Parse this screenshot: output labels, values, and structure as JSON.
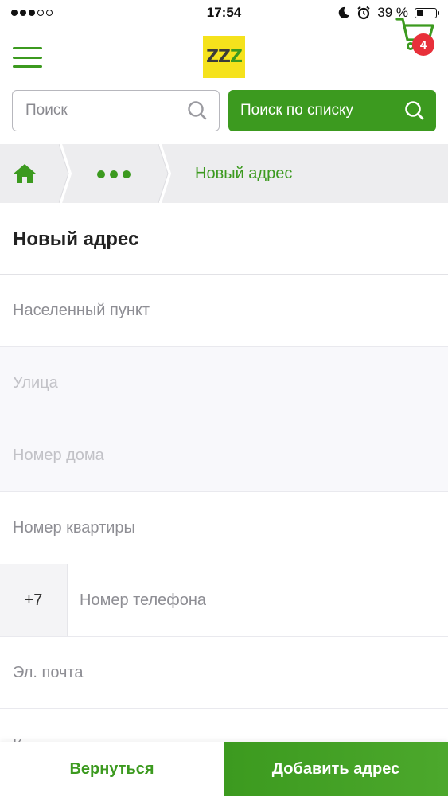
{
  "status_bar": {
    "time": "17:54",
    "battery_text": "39 %",
    "battery_level": 0.39,
    "signal_filled": 3,
    "signal_total": 5
  },
  "header": {
    "logo_letters": [
      "Z",
      "Z",
      "Z"
    ],
    "cart_count": "4",
    "colors": {
      "brand_green": "#3c9a1f",
      "logo_yellow": "#f5e21c",
      "badge_red": "#e8303a"
    }
  },
  "search": {
    "placeholder": "Поиск",
    "list_button_label": "Поиск по списку"
  },
  "breadcrumb": {
    "current": "Новый адрес"
  },
  "page": {
    "title": "Новый адрес"
  },
  "form": {
    "locality_placeholder": "Населенный пункт",
    "street_placeholder": "Улица",
    "house_placeholder": "Номер дома",
    "apartment_placeholder": "Номер квартиры",
    "phone_prefix": "+7",
    "phone_placeholder": "Номер телефона",
    "email_placeholder": "Эл. почта",
    "comment_placeholder": "К"
  },
  "actions": {
    "back_label": "Вернуться",
    "add_label": "Добавить адрес"
  }
}
